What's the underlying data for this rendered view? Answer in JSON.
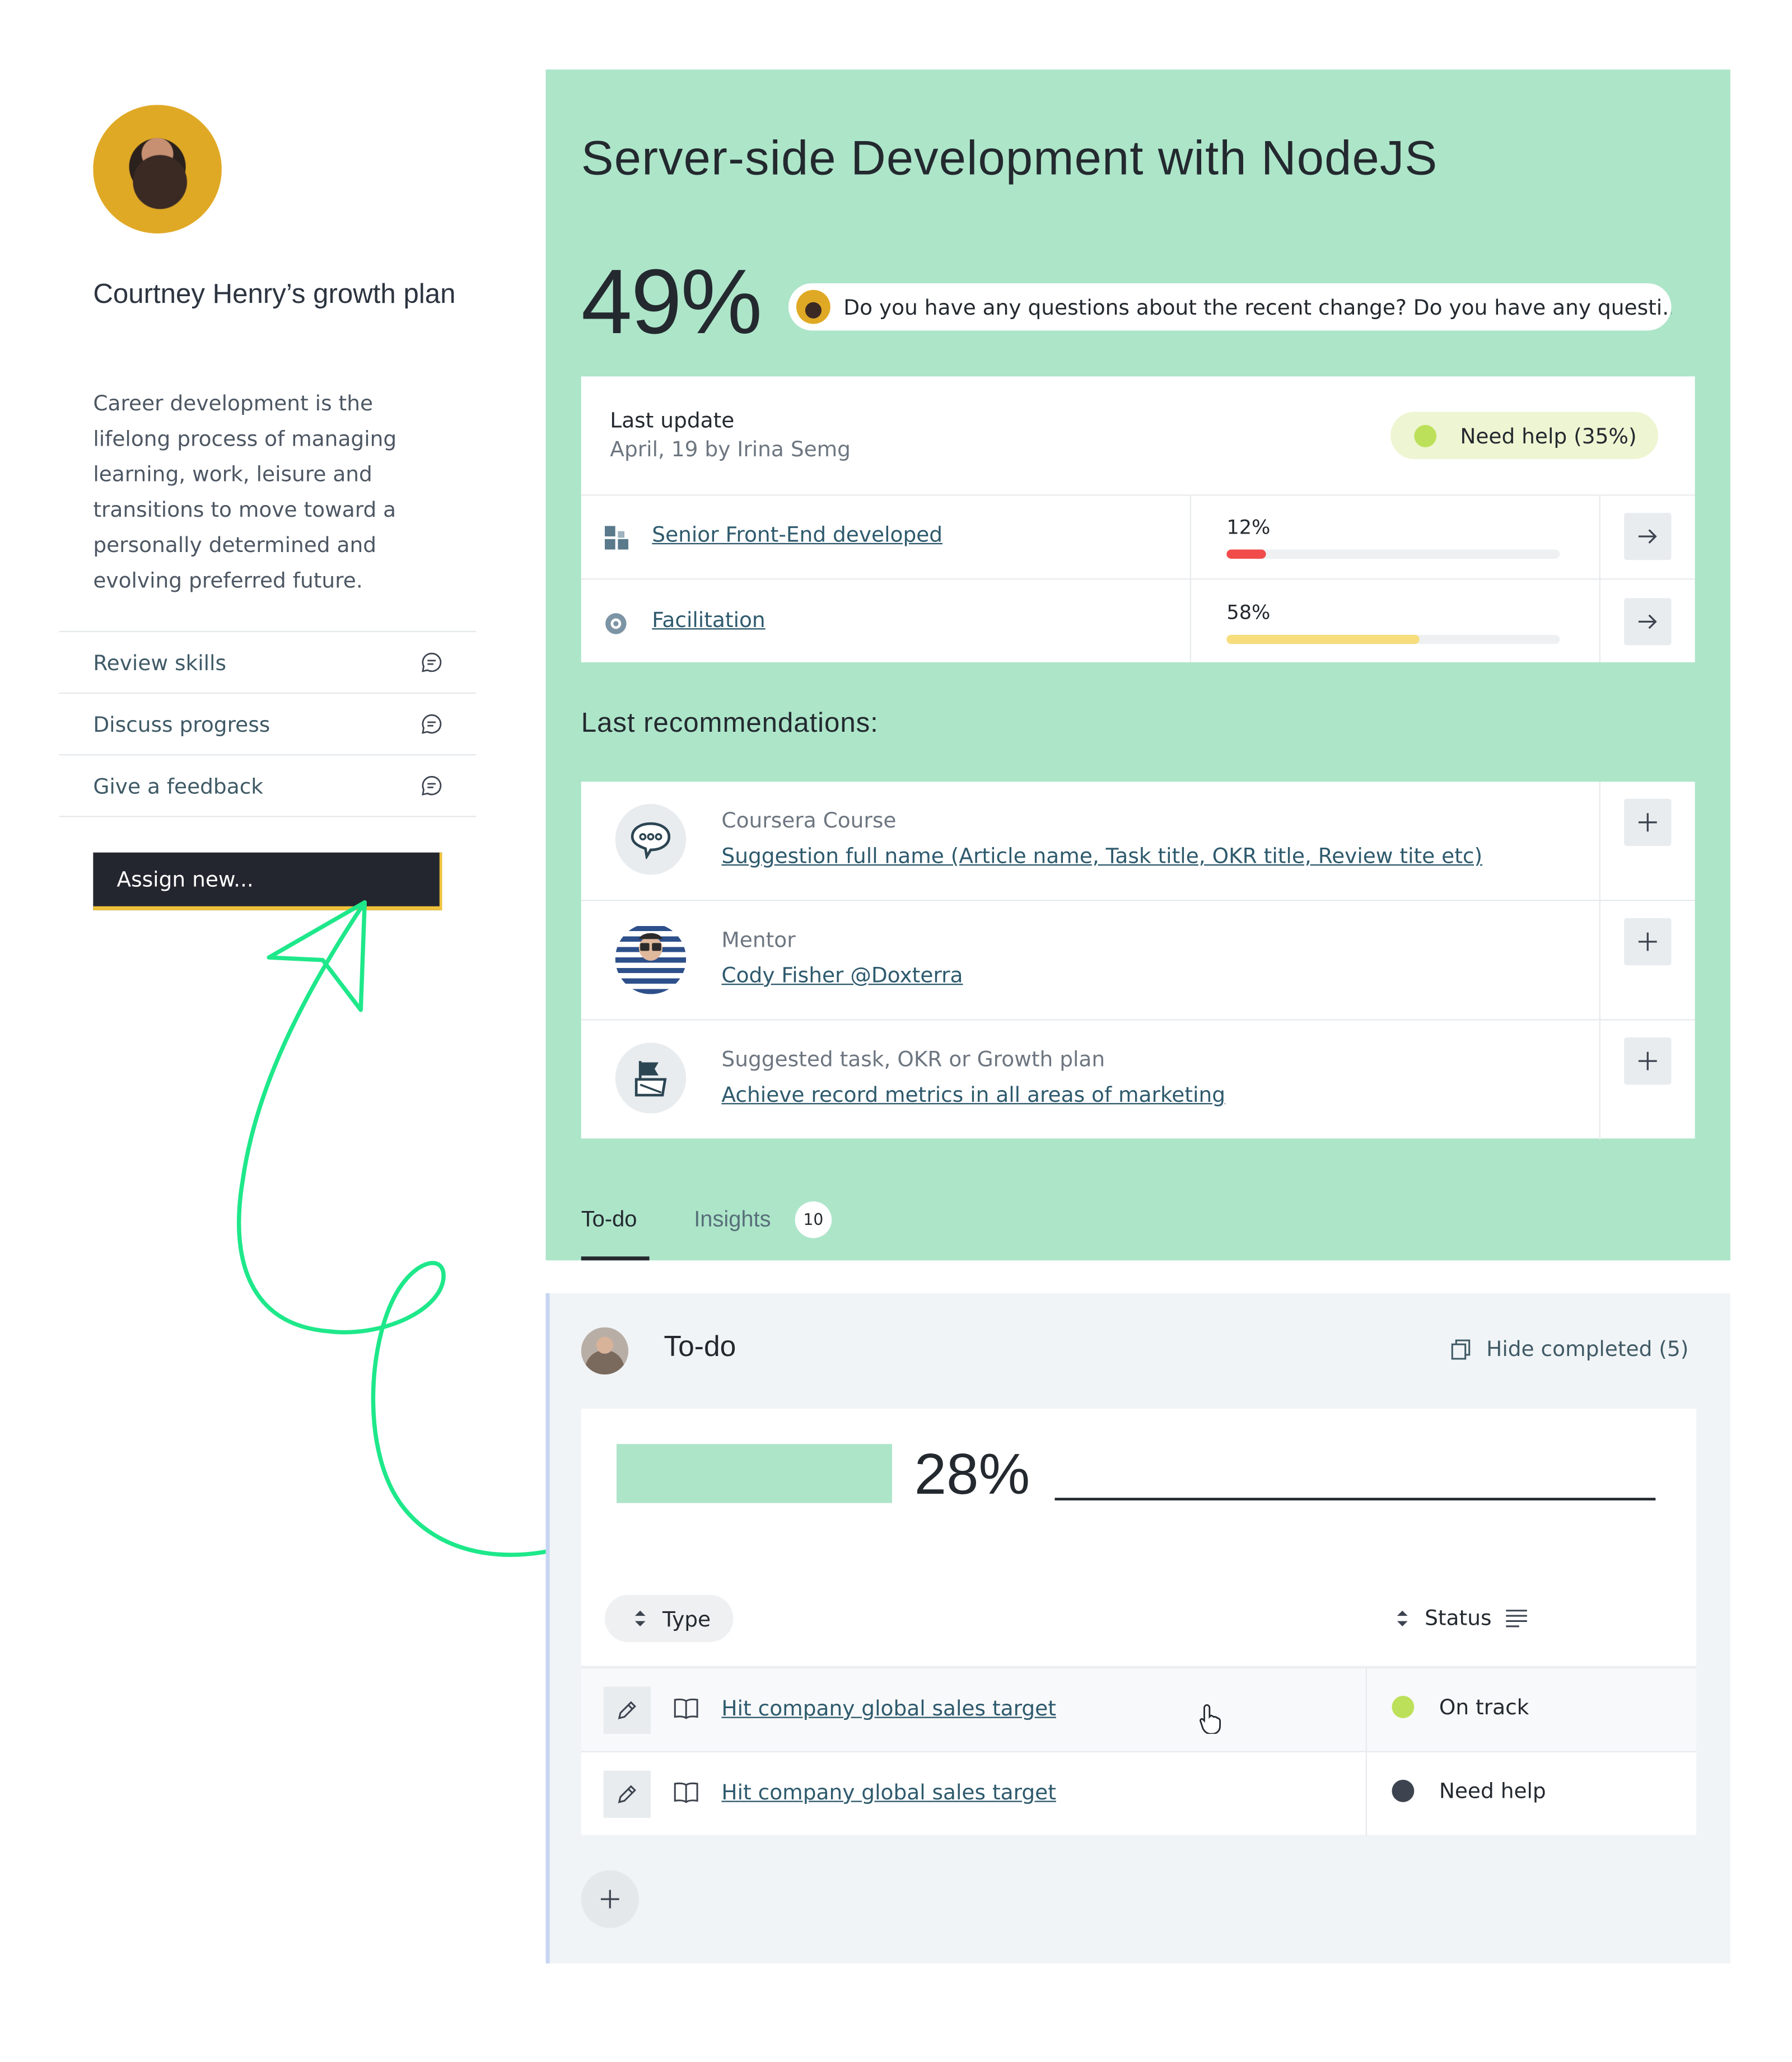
{
  "profile": {
    "title": "Courtney Henry’s growth plan",
    "description": "Career development is the lifelong process of managing learning, work, leisure and transitions to move toward a personally determined and evolving preferred future.",
    "menu": [
      {
        "label": "Review skills",
        "icon": "chat-icon"
      },
      {
        "label": "Discuss progress",
        "icon": "chat-icon"
      },
      {
        "label": "Give a feedback",
        "icon": "chat-icon"
      }
    ],
    "assign_label": "Assign new..."
  },
  "course": {
    "title": "Server-side Development with NodeJS",
    "progress_label": "49%",
    "progress": 0.49,
    "question": "Do you have any questions about the recent change? Do you have any questi...",
    "last_update_label": "Last update",
    "last_update_detail": "April, 19 by Irina Semg",
    "help_status": "Need help (35%)",
    "help_color": "#bde05a",
    "skills": [
      {
        "name": "Senior Front-End developed",
        "icon": "blocks-icon",
        "percent_label": "12%",
        "percent": 12,
        "color": "#f24b4b"
      },
      {
        "name": "Facilitation",
        "icon": "target-icon",
        "percent_label": "58%",
        "percent": 58,
        "color": "#f7dd7c"
      }
    ]
  },
  "recommendations": {
    "heading": "Last recommendations:",
    "items": [
      {
        "type": "Coursera Course",
        "name": "Suggestion full name (Article name, Task title, OKR title, Review tite etc)",
        "icon": "speech-bubble-icon"
      },
      {
        "type": "Mentor",
        "name": "Cody Fisher @Doxterra",
        "icon": "mentor-avatar"
      },
      {
        "type": "Suggested task, OKR or Growth plan",
        "name": "Achieve record metrics in all areas of marketing",
        "icon": "flag-icon"
      }
    ]
  },
  "tabs": {
    "todo": "To-do",
    "insights": "Insights",
    "insights_count": "10"
  },
  "todo": {
    "title": "To-do",
    "hide_completed": "Hide completed (5)",
    "progress_label": "28%",
    "progress": 0.28,
    "type_label": "Type",
    "status_label": "Status",
    "tasks": [
      {
        "name": "Hit company global sales target",
        "status": "On track",
        "status_color": "#bde05a"
      },
      {
        "name": "Hit company global sales target",
        "status": "Need help",
        "status_color": "#3d4450"
      }
    ]
  },
  "colors": {
    "accent_green": "#ade5c9",
    "arrow_green": "#1ee88a",
    "dark": "#24262f",
    "button_edge": "#f0c23b"
  }
}
